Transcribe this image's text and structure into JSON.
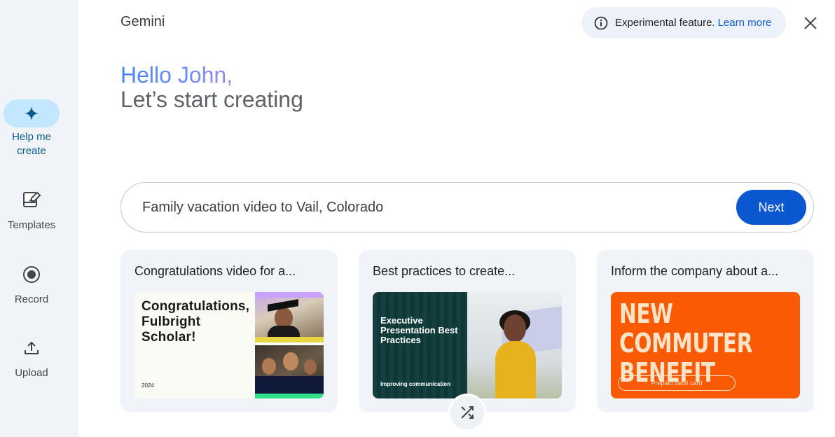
{
  "sidebar": {
    "items": [
      {
        "label": "Help me create",
        "icon": "sparkle-icon",
        "active": true
      },
      {
        "label": "Templates",
        "icon": "templates-icon",
        "active": false
      },
      {
        "label": "Record",
        "icon": "record-icon",
        "active": false
      },
      {
        "label": "Upload",
        "icon": "upload-icon",
        "active": false
      }
    ]
  },
  "header": {
    "app_title": "Gemini",
    "notice_text": "Experimental feature.",
    "notice_link": "Learn more",
    "close_icon": "close-icon"
  },
  "greeting": {
    "line1": "Hello John,",
    "line2": "Let’s start creating"
  },
  "prompt": {
    "value": "Family vacation video to Vail, Colorado",
    "next_label": "Next"
  },
  "suggestions": [
    {
      "title": "Congratulations video for a...",
      "thumb_heading": "Congratulations, Fulbright Scholar!",
      "thumb_year": "2024"
    },
    {
      "title": "Best practices to create...",
      "thumb_heading": "Executive Presentation Best Practices",
      "thumb_sub": "Improving communication"
    },
    {
      "title": "Inform the company about a...",
      "thumb_heading": "NEW COMMUTER BENEFIT",
      "thumb_sub": "Prepaid debit card"
    }
  ],
  "shuffle_icon": "shuffle-icon",
  "colors": {
    "accent": "#0b57d0",
    "sidebar_bg": "#f0f4f9",
    "active_pill": "#c2e7ff",
    "card_bg": "#f0f4f9",
    "orange": "#fb5a04"
  }
}
